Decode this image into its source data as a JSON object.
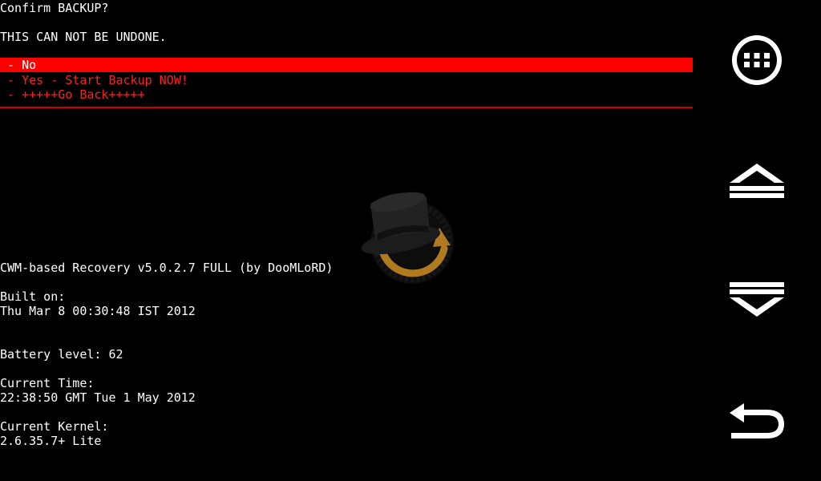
{
  "prompt": {
    "title": "Confirm BACKUP?",
    "warning": "THIS CAN NOT BE UNDONE."
  },
  "menu": {
    "items": [
      {
        "label": " - No",
        "selected": true
      },
      {
        "label": " - Yes - Start Backup NOW!",
        "selected": false
      },
      {
        "label": " - +++++Go Back+++++",
        "selected": false
      }
    ]
  },
  "info": {
    "version": "CWM-based Recovery v5.0.2.7 FULL (by DooMLoRD)",
    "built_label": "Built on:",
    "built_value": "Thu Mar 8 00:30:48 IST 2012",
    "battery": "Battery level: 62",
    "time_label": "Current Time:",
    "time_value": "22:38:50 GMT Tue 1 May 2012",
    "kernel_label": "Current Kernel:",
    "kernel_value": "2.6.35.7+ Lite"
  },
  "logo": {
    "icon": "clockworkmod-hat-icon"
  },
  "nav": {
    "menu": {
      "icon": "menu-dots-icon"
    },
    "up": {
      "icon": "up-arrow-icon"
    },
    "down": {
      "icon": "down-arrow-icon"
    },
    "back": {
      "icon": "back-arrow-icon"
    }
  },
  "colors": {
    "background": "#000000",
    "text": "#ffffff",
    "menu_text": "#ff2020",
    "highlight": "#ff0000"
  }
}
